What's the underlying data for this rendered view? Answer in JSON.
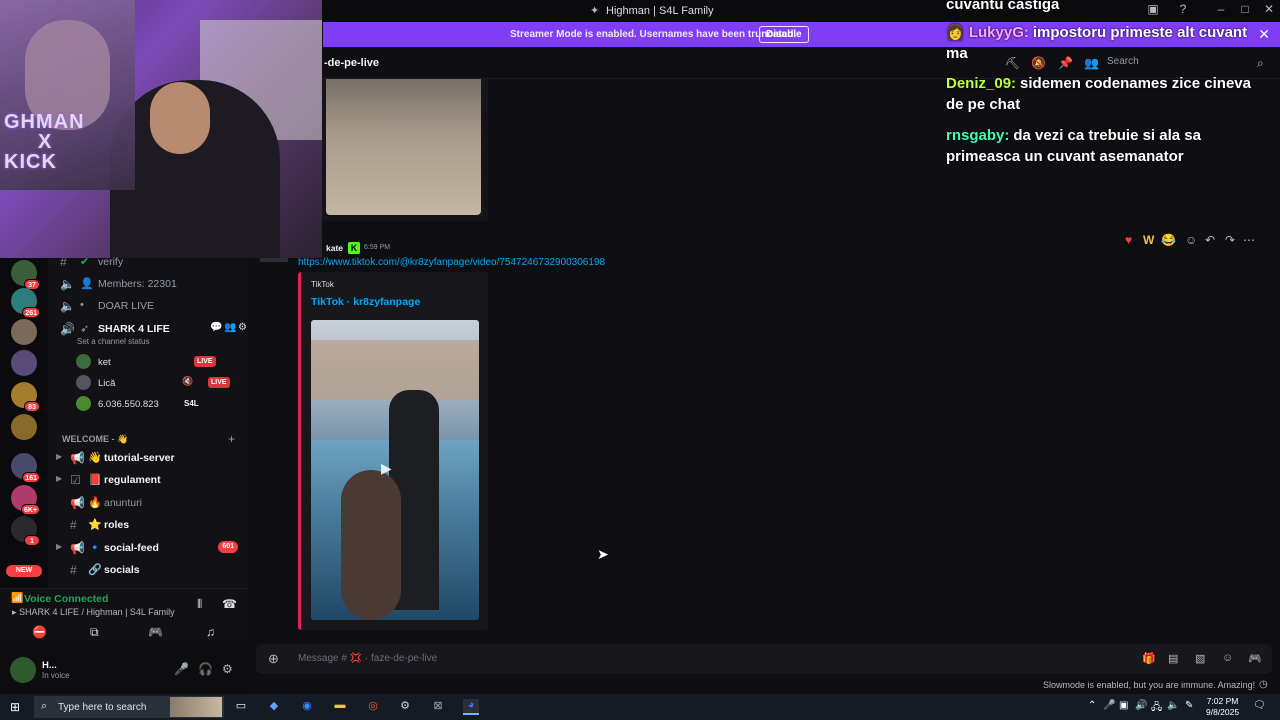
{
  "window": {
    "title": "Highman | S4L Family"
  },
  "banner": {
    "text": "Streamer Mode is enabled. Usernames have been truncated.",
    "disable_label": "Disable"
  },
  "channel_header": {
    "name": "-de-pe-live",
    "search_placeholder": "Search"
  },
  "stream_overlay": {
    "logo_lines": [
      "GHMAN",
      "X",
      "KICK"
    ],
    "chat": [
      {
        "user": "",
        "text": "cuvantu castiga",
        "color": "#ffffff"
      },
      {
        "user": "LukyyG:",
        "text": "impostoru primeste alt cuvant ma",
        "color": "#f9a8ff"
      },
      {
        "user": "Deniz_09:",
        "text": "sidemen codenames zice cineva de pe chat",
        "color": "#b8ff3d"
      },
      {
        "user": "rnsgaby:",
        "text": "da vezi ca trebuie si ala sa primeasca un cuvant asemanator",
        "color": "#3dffb0"
      }
    ]
  },
  "servers": [
    {
      "badge": "37",
      "color": "#3a5e3a"
    },
    {
      "badge": "261",
      "color": "#2e7d7d"
    },
    {
      "badge": "",
      "color": "#7a6a5a"
    },
    {
      "badge": "",
      "color": "#5a4a7a"
    },
    {
      "badge": "83",
      "color": "#a67c2e"
    },
    {
      "badge": "",
      "color": "#8a6a2a"
    },
    {
      "badge": "161",
      "color": "#4a4a6a"
    },
    {
      "badge": "6K+",
      "color": "#b03a6a"
    },
    {
      "badge": "1",
      "color": "#2a2a2e"
    }
  ],
  "new_label": "NEW",
  "channels": {
    "verify": "verify",
    "members": "Members: 22301",
    "doar_live": "DOAR LIVE",
    "voice_channel": "SHARK 4 LIFE",
    "voice_status": "Set a channel status",
    "voice_users": [
      {
        "name": "ket",
        "live": "LIVE"
      },
      {
        "name": "Lică",
        "live": "LIVE"
      },
      {
        "name": "6.036.550.823",
        "tag": "S4L"
      }
    ],
    "category": "WELCOME - 👋",
    "list": [
      {
        "name": "tutorial-server",
        "emoji": "👋",
        "badge": ""
      },
      {
        "name": "regulament",
        "emoji": "📕",
        "badge": ""
      },
      {
        "name": "anunturi",
        "emoji": "🔥",
        "badge": ""
      },
      {
        "name": "roles",
        "emoji": "⭐",
        "badge": ""
      },
      {
        "name": "social-feed",
        "emoji": "🔹",
        "badge": "601"
      },
      {
        "name": "socials",
        "emoji": "🔗",
        "badge": ""
      }
    ]
  },
  "voice_panel": {
    "title": "Voice Connected",
    "subtitle": "SHARK 4 LIFE / Highman | S4L Family"
  },
  "user_panel": {
    "name": "H...",
    "status": "In voice"
  },
  "message": {
    "author": "kate",
    "time": "6:59 PM",
    "link": "https://www.tiktok.com/@kr8zyfanpage/video/7547246732900306198",
    "embed_provider": "TikTok",
    "embed_title": "TikTok · kr8zyfanpage"
  },
  "composer": {
    "placeholder": "Message # 💢 · faze-de-pe-live",
    "slowmode": "Slowmode is enabled, but you are immune. Amazing!"
  },
  "taskbar": {
    "search_placeholder": "Type here to search",
    "time": "7:02 PM",
    "date": "9/8/2025"
  }
}
